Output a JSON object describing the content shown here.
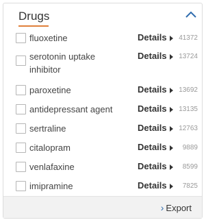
{
  "panel": {
    "title": "Drugs",
    "accent_color": "#e0803a",
    "collapse_icon": "chevron-up-icon",
    "details_label": "Details",
    "items": [
      {
        "label": "fluoxetine",
        "count": "41372"
      },
      {
        "label": "serotonin uptake inhibitor",
        "count": "13724"
      },
      {
        "label": "paroxetine",
        "count": "13692"
      },
      {
        "label": "antidepressant agent",
        "count": "13135"
      },
      {
        "label": "sertraline",
        "count": "12763"
      },
      {
        "label": "citalopram",
        "count": "9889"
      },
      {
        "label": "venlafaxine",
        "count": "8599"
      },
      {
        "label": "imipramine",
        "count": "7825"
      }
    ],
    "export_label": "Export"
  }
}
